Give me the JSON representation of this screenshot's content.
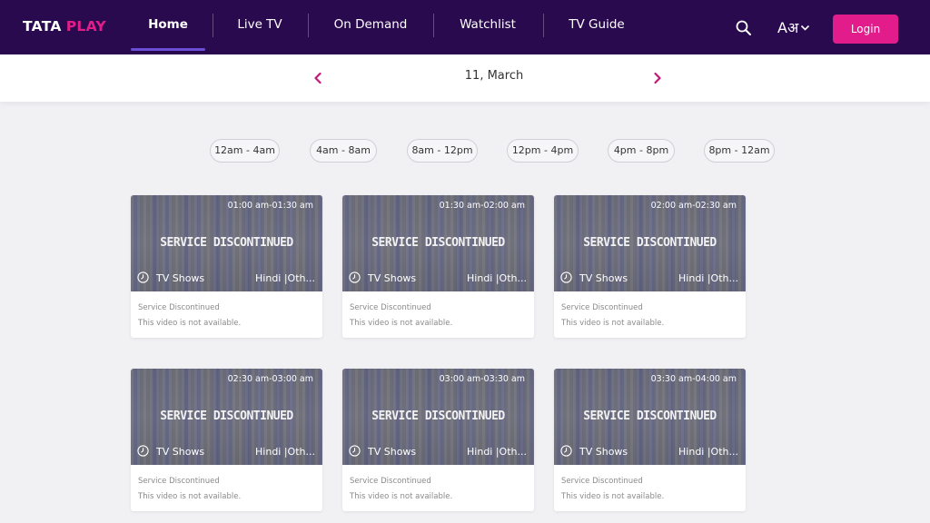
{
  "brand": {
    "word1": "TATA",
    "word2": "PLAY",
    "primary_color": "#2a0a4e",
    "accent_color": "#e21d8b"
  },
  "nav": {
    "items": [
      {
        "label": "Home",
        "active": true
      },
      {
        "label": "Live TV"
      },
      {
        "label": "On Demand"
      },
      {
        "label": "Watchlist"
      },
      {
        "label": "TV Guide"
      }
    ],
    "search_icon": "search-icon",
    "language_label": "Aअ",
    "language_icon": "chevron-down-icon",
    "login_label": "Login"
  },
  "date_nav": {
    "date": "11, March",
    "prev_icon": "chevron-left-icon",
    "next_icon": "chevron-right-icon"
  },
  "time_slots": [
    "12am - 4am",
    "4am - 8am",
    "8am - 12pm",
    "12pm - 4pm",
    "4pm - 8pm",
    "8pm - 12am"
  ],
  "cards": [
    {
      "time": "01:00 am-01:30 am",
      "overlay": "SERVICE DISCONTINUED",
      "genre": "TV Shows",
      "language": "Hindi |Oth...",
      "title": "Service Discontinued",
      "description": "This video is not available."
    },
    {
      "time": "01:30 am-02:00 am",
      "overlay": "SERVICE DISCONTINUED",
      "genre": "TV Shows",
      "language": "Hindi |Oth...",
      "title": "Service Discontinued",
      "description": "This video is not available."
    },
    {
      "time": "02:00 am-02:30 am",
      "overlay": "SERVICE DISCONTINUED",
      "genre": "TV Shows",
      "language": "Hindi |Oth...",
      "title": "Service Discontinued",
      "description": "This video is not available."
    },
    {
      "time": "02:30 am-03:00 am",
      "overlay": "SERVICE DISCONTINUED",
      "genre": "TV Shows",
      "language": "Hindi |Oth...",
      "title": "Service Discontinued",
      "description": "This video is not available."
    },
    {
      "time": "03:00 am-03:30 am",
      "overlay": "SERVICE DISCONTINUED",
      "genre": "TV Shows",
      "language": "Hindi |Oth...",
      "title": "Service Discontinued",
      "description": "This video is not available."
    },
    {
      "time": "03:30 am-04:00 am",
      "overlay": "SERVICE DISCONTINUED",
      "genre": "TV Shows",
      "language": "Hindi |Oth...",
      "title": "Service Discontinued",
      "description": "This video is not available."
    }
  ]
}
